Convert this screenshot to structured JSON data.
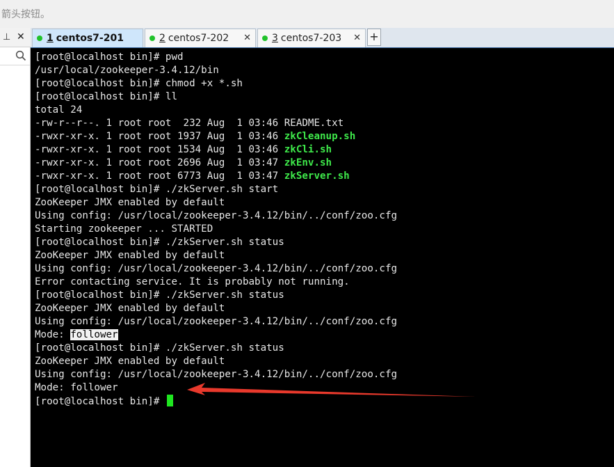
{
  "hint_text": "箭头按钮。",
  "tabs": [
    {
      "num": "1",
      "label": "centos7-201",
      "status": "connected"
    },
    {
      "num": "2",
      "label": "centos7-202",
      "status": "connected"
    },
    {
      "num": "3",
      "label": "centos7-203",
      "status": "connected"
    }
  ],
  "add_tab_label": "+",
  "close_glyph": "✕",
  "pin_glyph": "⊥",
  "colors": {
    "connected_dot": "#21c22b",
    "terminal_bg": "#000000",
    "terminal_fg": "#e8e8e8",
    "executable_file": "#3ee84a",
    "cursor": "#1fe620",
    "annotation_arrow": "#e8392c"
  },
  "terminal": {
    "lines": [
      "[root@localhost bin]# pwd",
      "/usr/local/zookeeper-3.4.12/bin",
      "[root@localhost bin]# chmod +x *.sh",
      "[root@localhost bin]# ll",
      "total 24",
      {
        "prefix": "-rw-r--r--. 1 root root  232 Aug  1 03:46 ",
        "file": "README.txt",
        "exec": false
      },
      {
        "prefix": "-rwxr-xr-x. 1 root root 1937 Aug  1 03:46 ",
        "file": "zkCleanup.sh",
        "exec": true
      },
      {
        "prefix": "-rwxr-xr-x. 1 root root 1534 Aug  1 03:46 ",
        "file": "zkCli.sh",
        "exec": true
      },
      {
        "prefix": "-rwxr-xr-x. 1 root root 2696 Aug  1 03:47 ",
        "file": "zkEnv.sh",
        "exec": true
      },
      {
        "prefix": "-rwxr-xr-x. 1 root root 6773 Aug  1 03:47 ",
        "file": "zkServer.sh",
        "exec": true
      },
      "[root@localhost bin]# ./zkServer.sh start",
      "ZooKeeper JMX enabled by default",
      "Using config: /usr/local/zookeeper-3.4.12/bin/../conf/zoo.cfg",
      "Starting zookeeper ... STARTED",
      "[root@localhost bin]# ./zkServer.sh status",
      "ZooKeeper JMX enabled by default",
      "Using config: /usr/local/zookeeper-3.4.12/bin/../conf/zoo.cfg",
      "Error contacting service. It is probably not running.",
      "[root@localhost bin]# ./zkServer.sh status",
      "ZooKeeper JMX enabled by default",
      "Using config: /usr/local/zookeeper-3.4.12/bin/../conf/zoo.cfg",
      {
        "prefix": "Mode: ",
        "highlight": "follower"
      },
      "[root@localhost bin]# ./zkServer.sh status",
      "ZooKeeper JMX enabled by default",
      "Using config: /usr/local/zookeeper-3.4.12/bin/../conf/zoo.cfg",
      "Mode: follower",
      {
        "prefix": "[root@localhost bin]# ",
        "cursor": true
      }
    ]
  }
}
